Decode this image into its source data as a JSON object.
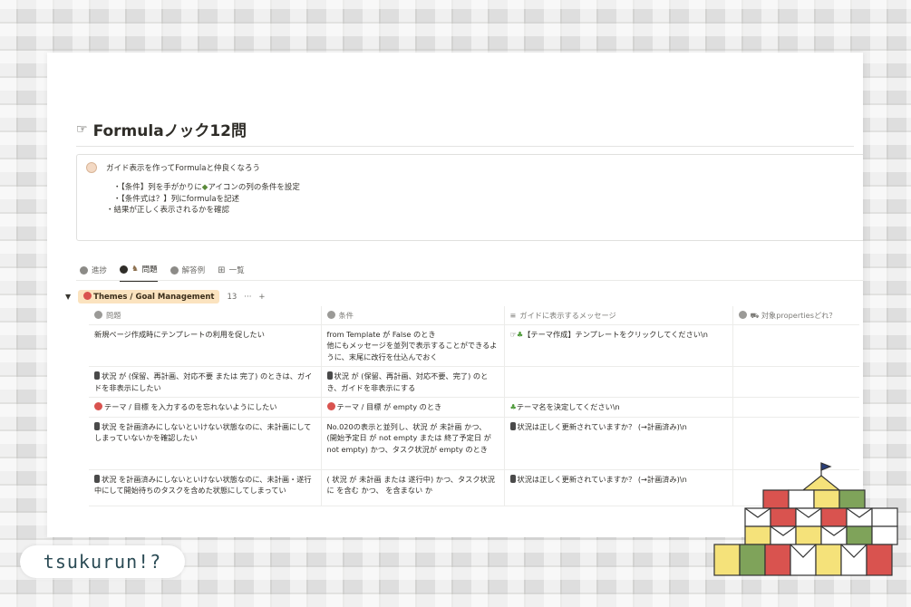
{
  "page": {
    "title": "Formulaノック12問",
    "title_icon": "pointing-hand-icon"
  },
  "callout": {
    "heading": "ガイド表示を作ってFormulaと仲良くなろう",
    "items": [
      "・【条件】列を手がかりに",
      "アイコンの列の条件を設定",
      "・【条件式は？】列にformulaを記述",
      "・結果が正しく表示されるかを確認"
    ]
  },
  "tabs": [
    {
      "label": "進捗",
      "icon": "check-circle-icon",
      "active": false
    },
    {
      "label": "問題",
      "icon": "question-circle-icon",
      "active": true
    },
    {
      "label": "解答例",
      "icon": "check-circle-icon",
      "active": false
    },
    {
      "label": "一覧",
      "icon": "table-icon",
      "active": false
    }
  ],
  "group": {
    "label": "Themes / Goal Management",
    "count": "13",
    "more": "···",
    "add": "+"
  },
  "columns": [
    "問題",
    "条件",
    "ガイドに表示するメッセージ",
    "対象propertiesどれ？"
  ],
  "rows": [
    {
      "problem": "新規ページ作成時にテンプレートの利用を促したい",
      "condition": "from Template が False のとき\n他にもメッセージを並列で表示することができるように、末尾に改行を仕込んでおく",
      "message": "【テーマ作成】テンプレートをクリックしてください\\n",
      "target": ""
    },
    {
      "problem": "状況 が (保留、再計画、対応不要 または 完了) のときは、ガイドを非表示にしたい",
      "condition": "状況 が (保留、再計画、対応不要、完了) のとき、ガイドを非表示にする",
      "message": "",
      "target": ""
    },
    {
      "problem": "テーマ / 目標 を入力するのを忘れないようにしたい",
      "condition": "テーマ / 目標 が empty のとき",
      "message": "テーマ名を決定してください\\n",
      "target": ""
    },
    {
      "problem": "状況 を計画済みにしないといけない状態なのに、未計画にしてしまっていないかを確認したい",
      "condition": "No.020の表示と並列し、状況 が 未計画 かつ、 (開始予定日 が not empty または 終了予定日 が not empty) かつ、タスク状況が empty のとき",
      "message": "状況は正しく更新されていますか？ (→計画済み)\\n",
      "target": ""
    },
    {
      "problem": "状況 を計画済みにしないといけない状態なのに、未計画・遂行中にして開始待ちのタスクを含めた状態にしてしまってい",
      "condition": "( 状況 が 未計画 または 遂行中) かつ、タスク状況 に を含む かつ、 を含まない か",
      "message": "状況は正しく更新されていますか？ (→計画済み)\\n",
      "target": ""
    }
  ],
  "brand": {
    "text": "tsukurun!?"
  },
  "colors": {
    "group_tag_bg": "#fbe3bf",
    "castle_red": "#d9534f",
    "castle_green": "#7fa35a",
    "castle_yellow": "#f5e27a",
    "brand_text": "#2b4b55"
  }
}
